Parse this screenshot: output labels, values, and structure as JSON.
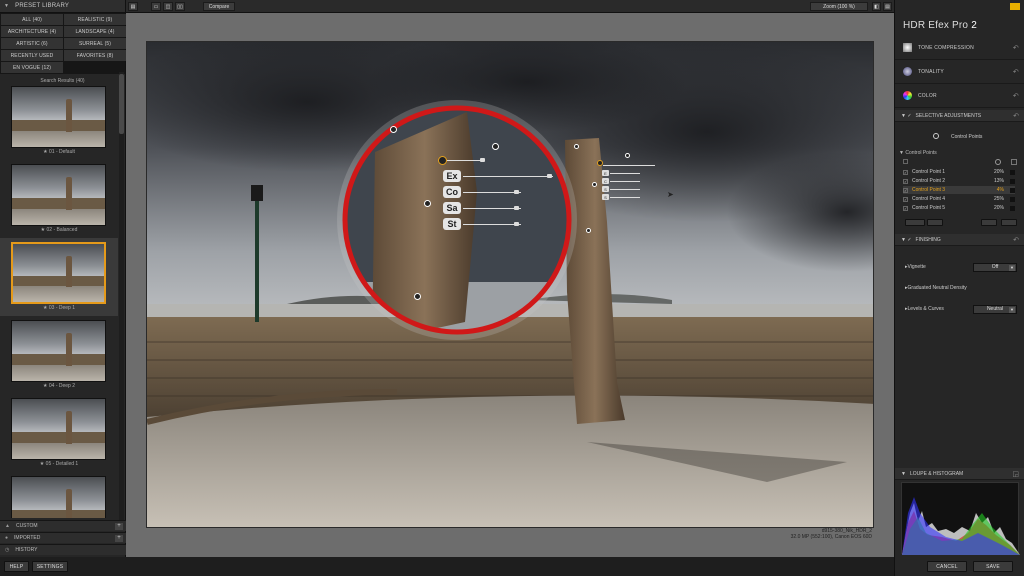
{
  "left_panel": {
    "title": "PRESET LIBRARY",
    "categories": [
      "ALL (40)",
      "REALISTIC (9)",
      "ARCHITECTURE (4)",
      "LANDSCAPE (4)",
      "ARTISTIC (6)",
      "SURREAL (5)",
      "RECENTLY USED",
      "FAVORITES (8)",
      "EN VOGUE (12)"
    ],
    "search_results": "Search Results (40)",
    "presets": [
      {
        "label": "★ 01 - Default"
      },
      {
        "label": "★ 02 - Balanced"
      },
      {
        "label": "★ 03 - Deep 1"
      },
      {
        "label": "★ 04 - Deep 2"
      },
      {
        "label": "★ 05 - Detailed 1"
      },
      {
        "label": ""
      }
    ],
    "selected_index": 2,
    "sections": {
      "custom": "CUSTOM",
      "imported": "IMPORTED",
      "history": "HISTORY"
    },
    "help": "HELP",
    "settings": "SETTINGS"
  },
  "toolbar": {
    "compare": "Compare",
    "zoom": "Zoom (100 %)"
  },
  "image_info": {
    "filename": "d915-380_Nik_HDR_2",
    "meta": "32.0 MP (552:100), Canon EOS 60D"
  },
  "right_panel": {
    "app_name": "HDR Efex Pro",
    "app_version": "2",
    "sections": {
      "tone": "TONE COMPRESSION",
      "tonality": "TONALITY",
      "color": "COLOR",
      "selective": "SELECTIVE ADJUSTMENTS",
      "control_points_btn": "Control Points",
      "control_points_hdr": "Control Points",
      "finishing": "FINISHING",
      "vignette": "Vignette",
      "vignette_value": "Off",
      "gnd": "Graduated Neutral Density",
      "levels": "Levels & Curves",
      "levels_value": "Neutral",
      "loupe": "LOUPE & HISTOGRAM"
    },
    "control_points": [
      {
        "name": "Control Point 1",
        "pct": "20%"
      },
      {
        "name": "Control Point 2",
        "pct": "13%"
      },
      {
        "name": "Control Point 3",
        "pct": "4%"
      },
      {
        "name": "Control Point 4",
        "pct": "25%"
      },
      {
        "name": "Control Point 5",
        "pct": "20%"
      }
    ],
    "selected_cp": 2
  },
  "bottom": {
    "cancel": "CANCEL",
    "save": "SAVE"
  },
  "loupe_labels": [
    "Ex",
    "Co",
    "Sa",
    "St"
  ],
  "small_labels": [
    "E",
    "C",
    "S",
    "S"
  ],
  "colors": {
    "accent": "#e59a1a",
    "loupe_ring": "#d01818"
  }
}
